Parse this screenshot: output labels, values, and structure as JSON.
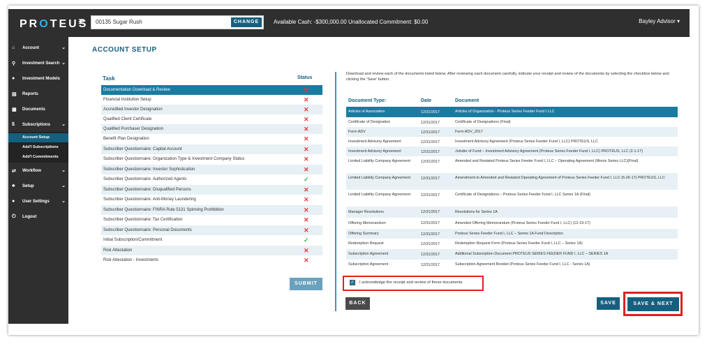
{
  "header": {
    "logo_pre": "PR",
    "logo_o": "O",
    "logo_post": "TEUS",
    "account": "00135 Sugar Rush",
    "change_label": "CHANGE",
    "cash_text": "Available Cash: -$300,000.00   Unallocated Commitment: $0.00",
    "user": "Bayley Advisor ▾"
  },
  "sidebar": {
    "items": [
      {
        "label": "Account",
        "icon": "house-icon"
      },
      {
        "label": "Investment Search",
        "icon": "search-icon"
      },
      {
        "label": "Investment Models",
        "icon": "models-icon"
      },
      {
        "label": "Reports",
        "icon": "reports-icon"
      },
      {
        "label": "Documents",
        "icon": "documents-icon"
      },
      {
        "label": "Subscriptions",
        "icon": "subscriptions-icon"
      },
      {
        "label": "Workflow",
        "icon": "workflow-icon"
      },
      {
        "label": "Setup",
        "icon": "setup-icon"
      },
      {
        "label": "User Settings",
        "icon": "user-settings-icon"
      },
      {
        "label": "Logout",
        "icon": "logout-icon"
      }
    ],
    "subitems": [
      "Account Setup",
      "Add'l Subscriptions",
      "Add'l Commitments"
    ]
  },
  "page_title": "ACCOUNT SETUP",
  "tasks": {
    "header_task": "Task",
    "header_status": "Status",
    "rows": [
      {
        "name": "Documentation Download & Review",
        "status": "✕"
      },
      {
        "name": "Financial Institution Setup",
        "status": "✕"
      },
      {
        "name": "Accredited Investor Designation",
        "status": "✕"
      },
      {
        "name": "Qualified Client Certificate",
        "status": "✕"
      },
      {
        "name": "Qualified Purchaser Designation",
        "status": "✕"
      },
      {
        "name": "Benefit Plan Designation",
        "status": "✕"
      },
      {
        "name": "Subscriber Questionnaire: Capital Account",
        "status": "✕"
      },
      {
        "name": "Subscriber Questionnaire: Organization Type & Investment Company Status",
        "status": "✕"
      },
      {
        "name": "Subscriber Questionnaire: Investor Sophistication",
        "status": "✕"
      },
      {
        "name": "Subscriber Questionnaire: Authorized Agents",
        "status": "✓"
      },
      {
        "name": "Subscriber Questionnaire: Disqualified Persons",
        "status": "✕"
      },
      {
        "name": "Subscriber Questionnaire: Anti-Money Laundering",
        "status": "✕"
      },
      {
        "name": "Subscriber Questionnaire: FINRA Rule 5131 Spinning Prohibition",
        "status": "✕"
      },
      {
        "name": "Subscriber Questionnaire: Tax Certification",
        "status": "✕"
      },
      {
        "name": "Subscriber Questionnaire: Personal Documents",
        "status": "✕"
      },
      {
        "name": "Initial Subscription/Commitment",
        "status": "✓"
      },
      {
        "name": "Risk Attestation",
        "status": "✕"
      },
      {
        "name": "Risk Attestation - Investments",
        "status": "✕"
      }
    ],
    "submit_label": "SUBMIT"
  },
  "documents": {
    "intro": "Download and review each of the documents listed below. After reviewing each document carefully, indicate your receipt and review of the documents by selecting the checkbox below and clicking the 'Save' button.",
    "header_type": "Document Type:",
    "header_date": "Date",
    "header_doc": "Document",
    "rows": [
      {
        "type": "Articles of Association",
        "date": "12/31/2017",
        "doc": "Articles of Organization - Proteus Series Feeder Fund I LLC"
      },
      {
        "type": "Certificate of Designation",
        "date": "12/31/2017",
        "doc": "Certificate of Designations (Final)"
      },
      {
        "type": "Form ADV",
        "date": "12/31/2017",
        "doc": "Form ADV_2017"
      },
      {
        "type": "Investment Advisory Agreement",
        "date": "12/31/2017",
        "doc": "Investment Advisory Agreement (Proteus Series Feeder Fund I, LLC) PROTEUS, LLC"
      },
      {
        "type": "Investment Advisory Agreement",
        "date": "12/31/2017",
        "doc": "Joinder of Fund – Investment Advisory Agreement (Proteus Series Feeder Fund I, LLC) PROTEUS, LLC (2-1-17)"
      },
      {
        "type": "Limited Liability Company Agreement",
        "date": "12/31/2017",
        "doc": "Amended and Restated Proteus Series Feeder Fund I, LLC – Operating Agreement (Illinois Series LLC)(Final)"
      },
      {
        "type": "Limited Liability Company Agreement",
        "date": "12/31/2017",
        "doc": "Amendment to Amended and Restated Operating Agreement of Proteus Series Feeder Fund I, LLC (6-26-17) PROTEUS, LLC"
      },
      {
        "type": "Limited Liability Company Agreement",
        "date": "12/31/2017",
        "doc": "Certificate of Designations – Proteus Series Feeder Fund I, LLC Series 1A (Final)"
      },
      {
        "type": "Manager Resolutions",
        "date": "12/31/2017",
        "doc": "Resolutions for Series 1A"
      },
      {
        "type": "Offering Memorandum",
        "date": "12/31/2017",
        "doc": "Amended Offering Memorandum (Proteus Series Feeder Fund I, LLC) (12-19-17)"
      },
      {
        "type": "Offering Summary",
        "date": "12/31/2017",
        "doc": "Proteus Series Feeder Fund I, LLC – Series 1A Fund Description"
      },
      {
        "type": "Redemption Request",
        "date": "12/31/2017",
        "doc": "Redemption Request Form (Proteus Series Feeder Fund I, LLC – Series 1A)"
      },
      {
        "type": "Subscription Agreement",
        "date": "12/31/2017",
        "doc": "Additional Subscription Document PROTEUS SERIES FEEDER FUND I, LLC – SERIES 1A"
      },
      {
        "type": "Subscription Agreement",
        "date": "12/31/2017",
        "doc": "Subscription Agreement Booklet (Proteus Series Feeder Fund I, LLC - Series 1A)"
      }
    ],
    "ack_text": "I acknowledge the receipt and review of these documents",
    "back_label": "BACK",
    "save_label": "SAVE",
    "save_next_label": "SAVE & NEXT"
  },
  "colors": {
    "accent": "#15607e",
    "selected_row": "#1a7ba1",
    "error": "#e03a3a",
    "success": "#38b248",
    "highlight_outline": "#e02020"
  }
}
